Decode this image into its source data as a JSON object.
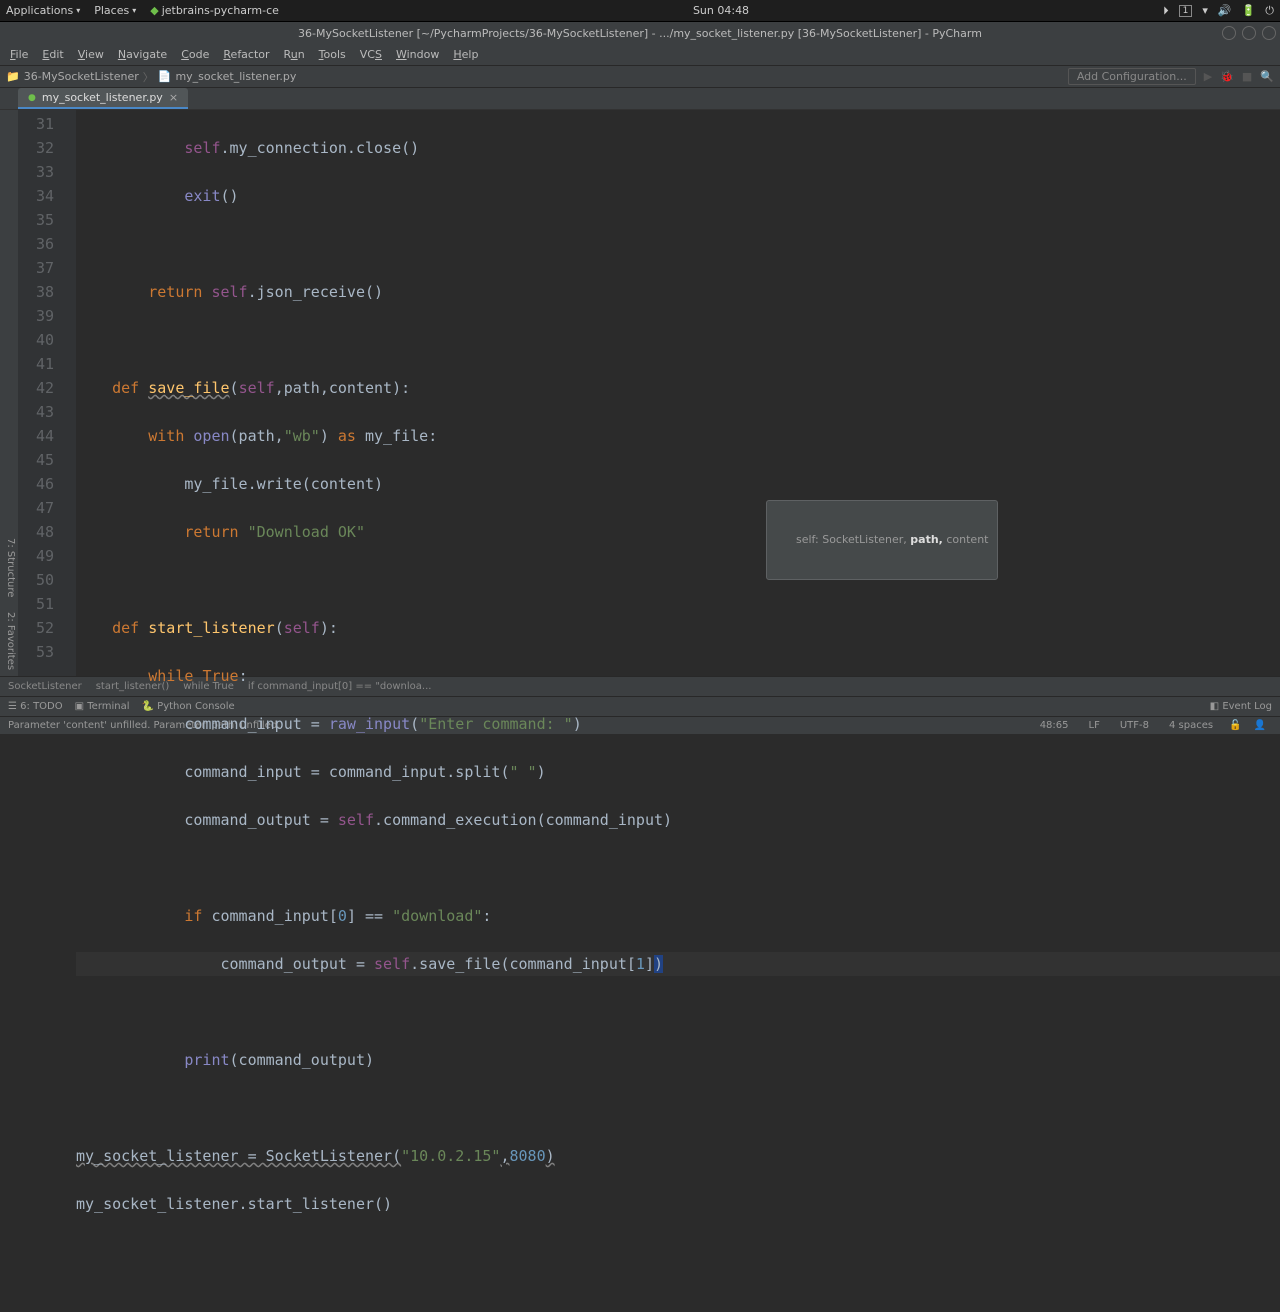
{
  "topbar": {
    "applications": "Applications",
    "places": "Places",
    "app": "jetbrains-pycharm-ce",
    "clock": "Sun 04:48"
  },
  "title": "36-MySocketListener [~/PycharmProjects/36-MySocketListener] - .../my_socket_listener.py [36-MySocketListener] - PyCharm",
  "menu": {
    "file": "File",
    "edit": "Edit",
    "view": "View",
    "navigate": "Navigate",
    "code": "Code",
    "refactor": "Refactor",
    "run": "Run",
    "tools": "Tools",
    "vcs": "VCS",
    "window": "Window",
    "help": "Help"
  },
  "breadcrumb": {
    "project": "36-MySocketListener",
    "file": "my_socket_listener.py"
  },
  "toolbar": {
    "add_config": "Add Configuration..."
  },
  "tab": {
    "name": "my_socket_listener.py"
  },
  "gutter": {
    "start": 31,
    "end": 53
  },
  "hint": {
    "prefix": "self: SocketListener, ",
    "bold": "path,",
    "suffix": " content"
  },
  "code_breadcrumb": {
    "c1": "SocketListener",
    "c2": "start_listener()",
    "c3": "while True",
    "c4": "if command_input[0] == \"downloa..."
  },
  "bottom": {
    "todo": "6: TODO",
    "terminal": "Terminal",
    "pyconsole": "Python Console",
    "eventlog": "Event Log"
  },
  "status": {
    "msg": "Parameter 'content' unfilled. Parameter 'path' unfilled.",
    "pos": "48:65",
    "lf": "LF",
    "enc": "UTF-8",
    "spaces": "4 spaces"
  },
  "left_tools": {
    "structure": "7: Structure",
    "favorites": "2: Favorites"
  },
  "code": {
    "l31": "            self.my_connection.close()",
    "l32": "            exit()",
    "l34": "        return self.json_receive()",
    "l36_def": "    def ",
    "l36_fn": "save_file",
    "l36_rest": "(self,path,content):",
    "l37_a": "        with ",
    "l37_open": "open",
    "l37_b": "(path,",
    "l37_s": "\"wb\"",
    "l37_c": ") as my_file:",
    "l38": "            my_file.write(content)",
    "l39_a": "            return ",
    "l39_s": "\"Download OK\"",
    "l41_a": "    def ",
    "l41_fn": "start_listener",
    "l41_b": "(self):",
    "l42_a": "        while ",
    "l42_b": "True:",
    "l43_a": "            command_input = ",
    "l43_fn": "raw_input",
    "l43_b": "(",
    "l43_s": "\"Enter command: \"",
    "l43_c": ")",
    "l44_a": "            command_input = command_input.split(",
    "l44_s": "\" \"",
    "l44_b": ")",
    "l45_a": "            command_output = ",
    "l45_self": "self",
    "l45_b": ".command_execution(command_input)",
    "l47_a": "            if ",
    "l47_b": "command_input[",
    "l47_n": "0",
    "l47_c": "] == ",
    "l47_s": "\"download\"",
    "l47_d": ":",
    "l48_a": "                command_output = ",
    "l48_self": "self",
    "l48_b": ".save_file(command_input[",
    "l48_n": "1",
    "l48_c": "])",
    "l50_a": "            ",
    "l50_fn": "print",
    "l50_b": "(command_output)",
    "l52_a": "my_socket_listener = SocketListener(",
    "l52_s": "\"10.0.2.15\"",
    "l52_b": ",",
    "l52_n": "8080",
    "l52_c": ")",
    "l53": "my_socket_listener.start_listener()"
  }
}
